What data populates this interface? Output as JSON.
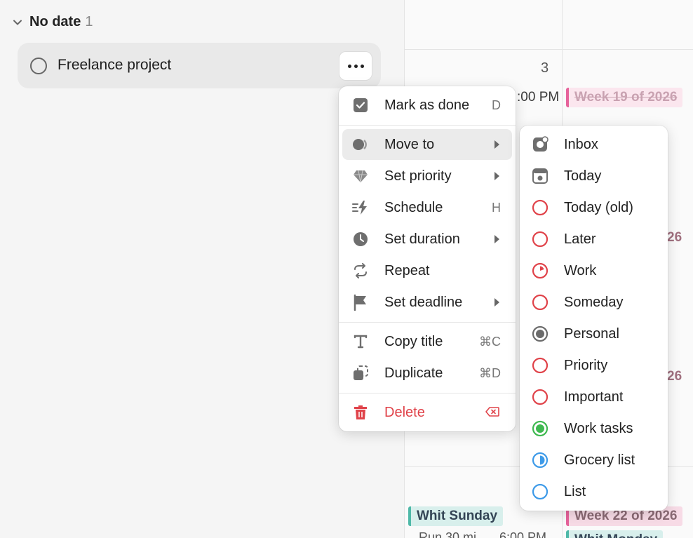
{
  "group": {
    "title": "No date",
    "count": "1"
  },
  "task": {
    "title": "Freelance project"
  },
  "calendar": {
    "day_number": "3",
    "time_partial": ":00 PM",
    "week19": "Week 19 of 2026",
    "partial_26_a": "26",
    "partial_26_b": "26",
    "whit_sunday": "Whit Sunday",
    "week22": "Week 22 of 2026",
    "run_partial": "Run 30 mi",
    "time_partial_2": "6:00 PM",
    "whit_monday": "Whit Monday"
  },
  "menu": {
    "items": [
      {
        "label": "Mark as done",
        "shortcut": "D",
        "icon": "checkbox-checked-icon"
      },
      {
        "label": "Move to",
        "icon": "move-to-icon",
        "submenu": true
      },
      {
        "label": "Set priority",
        "icon": "diamond-icon",
        "submenu": true
      },
      {
        "label": "Schedule",
        "shortcut": "H",
        "icon": "lightning-icon"
      },
      {
        "label": "Set duration",
        "icon": "clock-icon",
        "submenu": true
      },
      {
        "label": "Repeat",
        "icon": "repeat-icon"
      },
      {
        "label": "Set deadline",
        "icon": "flag-icon",
        "submenu": true
      },
      {
        "label": "Copy title",
        "shortcut": "⌘C",
        "icon": "text-icon"
      },
      {
        "label": "Duplicate",
        "shortcut": "⌘D",
        "icon": "duplicate-icon"
      },
      {
        "label": "Delete",
        "icon": "trash-icon"
      }
    ],
    "delete_shortcut_icon": "backspace-icon"
  },
  "submenu": {
    "items": [
      {
        "label": "Inbox",
        "icon": "inbox-icon"
      },
      {
        "label": "Today",
        "icon": "today-icon"
      },
      {
        "label": "Today (old)",
        "icon": "circle-icon",
        "color": "#e0434a"
      },
      {
        "label": "Later",
        "icon": "circle-icon",
        "color": "#e0434a"
      },
      {
        "label": "Work",
        "icon": "pie-circle-icon",
        "color": "#e0434a"
      },
      {
        "label": "Someday",
        "icon": "circle-icon",
        "color": "#e0434a"
      },
      {
        "label": "Personal",
        "icon": "radio-filled-icon",
        "color": "#6b6b6b"
      },
      {
        "label": "Priority",
        "icon": "circle-icon",
        "color": "#e0434a"
      },
      {
        "label": "Important",
        "icon": "circle-icon",
        "color": "#e0434a"
      },
      {
        "label": "Work tasks",
        "icon": "radio-filled-icon",
        "color": "#3fb950"
      },
      {
        "label": "Grocery list",
        "icon": "half-circle-icon",
        "color": "#3d9ae8"
      },
      {
        "label": "List",
        "icon": "circle-icon",
        "color": "#3d9ae8"
      }
    ]
  }
}
